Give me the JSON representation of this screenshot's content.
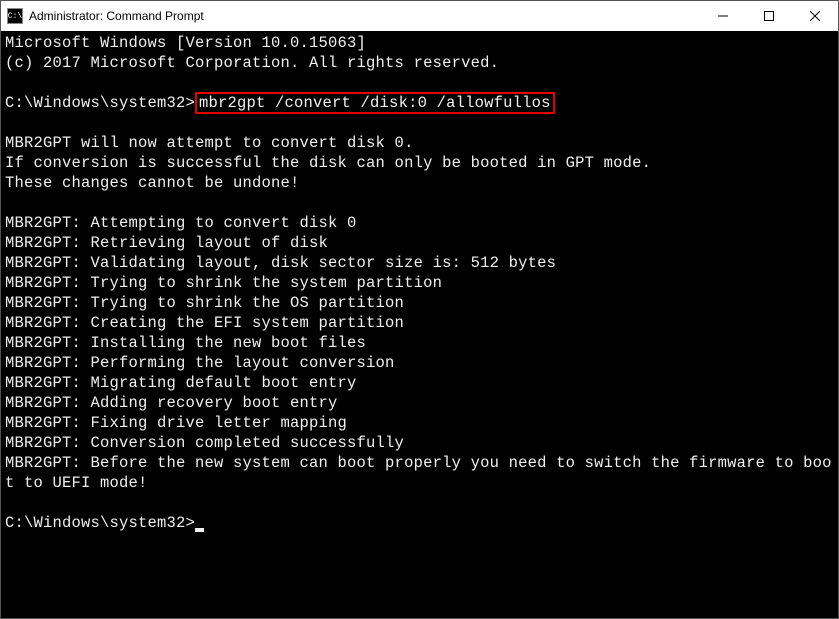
{
  "titlebar": {
    "icon_text": "C:\\",
    "title": "Administrator: Command Prompt"
  },
  "terminal": {
    "header_line1": "Microsoft Windows [Version 10.0.15063]",
    "header_line2": "(c) 2017 Microsoft Corporation. All rights reserved.",
    "prompt1": "C:\\Windows\\system32>",
    "command1": "mbr2gpt /convert /disk:0 /allowfullos",
    "warn_line1": "MBR2GPT will now attempt to convert disk 0.",
    "warn_line2": "If conversion is successful the disk can only be booted in GPT mode.",
    "warn_line3": "These changes cannot be undone!",
    "log_line1": "MBR2GPT: Attempting to convert disk 0",
    "log_line2": "MBR2GPT: Retrieving layout of disk",
    "log_line3": "MBR2GPT: Validating layout, disk sector size is: 512 bytes",
    "log_line4": "MBR2GPT: Trying to shrink the system partition",
    "log_line5": "MBR2GPT: Trying to shrink the OS partition",
    "log_line6": "MBR2GPT: Creating the EFI system partition",
    "log_line7": "MBR2GPT: Installing the new boot files",
    "log_line8": "MBR2GPT: Performing the layout conversion",
    "log_line9": "MBR2GPT: Migrating default boot entry",
    "log_line10": "MBR2GPT: Adding recovery boot entry",
    "log_line11": "MBR2GPT: Fixing drive letter mapping",
    "log_line12": "MBR2GPT: Conversion completed successfully",
    "log_line13": "MBR2GPT: Before the new system can boot properly you need to switch the firmware to boot to UEFI mode!",
    "prompt2": "C:\\Windows\\system32>"
  }
}
